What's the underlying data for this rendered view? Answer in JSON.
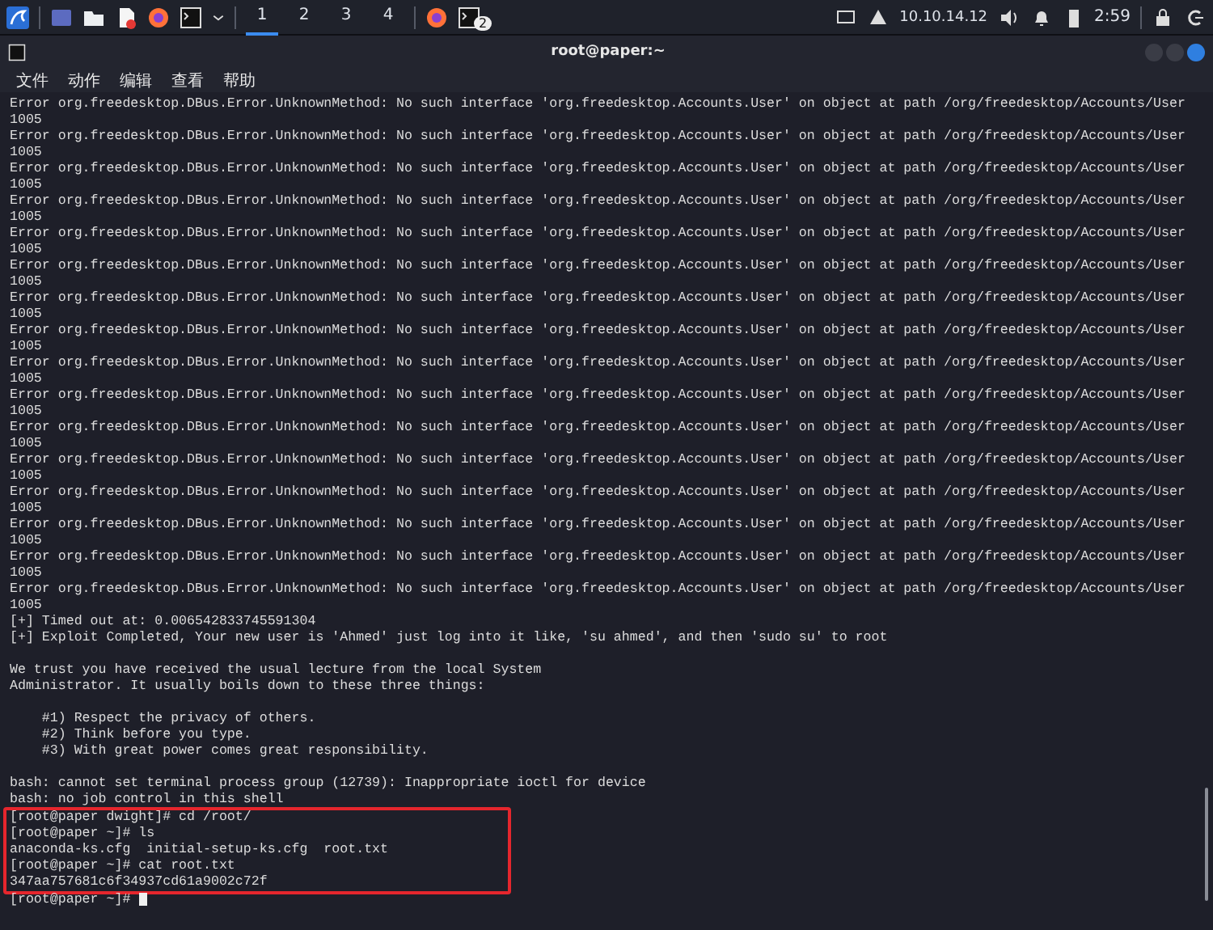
{
  "taskbar": {
    "workspaces": [
      {
        "label": "1",
        "selected": true
      },
      {
        "label": "2",
        "selected": false
      },
      {
        "label": "3",
        "selected": false
      },
      {
        "label": "4",
        "selected": false
      }
    ],
    "terminal_badge": "2",
    "ip": "10.10.14.12",
    "time": "2:59"
  },
  "window": {
    "title": "root@paper:~"
  },
  "menu": [
    "文件",
    "动作",
    "编辑",
    "查看",
    "帮助"
  ],
  "terminal": {
    "lines": [
      {
        "kind": "line",
        "text": "Error org.freedesktop.DBus.Error.UnknownMethod: No such interface 'org.freedesktop.Accounts.User' on object at path /org/freedesktop/Accounts/User"
      },
      {
        "kind": "line",
        "text": "1005"
      },
      {
        "kind": "line",
        "text": "Error org.freedesktop.DBus.Error.UnknownMethod: No such interface 'org.freedesktop.Accounts.User' on object at path /org/freedesktop/Accounts/User"
      },
      {
        "kind": "line",
        "text": "1005"
      },
      {
        "kind": "line",
        "text": "Error org.freedesktop.DBus.Error.UnknownMethod: No such interface 'org.freedesktop.Accounts.User' on object at path /org/freedesktop/Accounts/User"
      },
      {
        "kind": "line",
        "text": "1005"
      },
      {
        "kind": "line",
        "text": "Error org.freedesktop.DBus.Error.UnknownMethod: No such interface 'org.freedesktop.Accounts.User' on object at path /org/freedesktop/Accounts/User"
      },
      {
        "kind": "line",
        "text": "1005"
      },
      {
        "kind": "line",
        "text": "Error org.freedesktop.DBus.Error.UnknownMethod: No such interface 'org.freedesktop.Accounts.User' on object at path /org/freedesktop/Accounts/User"
      },
      {
        "kind": "line",
        "text": "1005"
      },
      {
        "kind": "line",
        "text": "Error org.freedesktop.DBus.Error.UnknownMethod: No such interface 'org.freedesktop.Accounts.User' on object at path /org/freedesktop/Accounts/User"
      },
      {
        "kind": "line",
        "text": "1005"
      },
      {
        "kind": "line",
        "text": "Error org.freedesktop.DBus.Error.UnknownMethod: No such interface 'org.freedesktop.Accounts.User' on object at path /org/freedesktop/Accounts/User"
      },
      {
        "kind": "line",
        "text": "1005"
      },
      {
        "kind": "line",
        "text": "Error org.freedesktop.DBus.Error.UnknownMethod: No such interface 'org.freedesktop.Accounts.User' on object at path /org/freedesktop/Accounts/User"
      },
      {
        "kind": "line",
        "text": "1005"
      },
      {
        "kind": "line",
        "text": "Error org.freedesktop.DBus.Error.UnknownMethod: No such interface 'org.freedesktop.Accounts.User' on object at path /org/freedesktop/Accounts/User"
      },
      {
        "kind": "line",
        "text": "1005"
      },
      {
        "kind": "line",
        "text": "Error org.freedesktop.DBus.Error.UnknownMethod: No such interface 'org.freedesktop.Accounts.User' on object at path /org/freedesktop/Accounts/User"
      },
      {
        "kind": "line",
        "text": "1005"
      },
      {
        "kind": "line",
        "text": "Error org.freedesktop.DBus.Error.UnknownMethod: No such interface 'org.freedesktop.Accounts.User' on object at path /org/freedesktop/Accounts/User"
      },
      {
        "kind": "line",
        "text": "1005"
      },
      {
        "kind": "line",
        "text": "Error org.freedesktop.DBus.Error.UnknownMethod: No such interface 'org.freedesktop.Accounts.User' on object at path /org/freedesktop/Accounts/User"
      },
      {
        "kind": "line",
        "text": "1005"
      },
      {
        "kind": "line",
        "text": "Error org.freedesktop.DBus.Error.UnknownMethod: No such interface 'org.freedesktop.Accounts.User' on object at path /org/freedesktop/Accounts/User"
      },
      {
        "kind": "line",
        "text": "1005"
      },
      {
        "kind": "line",
        "text": "Error org.freedesktop.DBus.Error.UnknownMethod: No such interface 'org.freedesktop.Accounts.User' on object at path /org/freedesktop/Accounts/User"
      },
      {
        "kind": "line",
        "text": "1005"
      },
      {
        "kind": "line",
        "text": "Error org.freedesktop.DBus.Error.UnknownMethod: No such interface 'org.freedesktop.Accounts.User' on object at path /org/freedesktop/Accounts/User"
      },
      {
        "kind": "line",
        "text": "1005"
      },
      {
        "kind": "line",
        "text": "Error org.freedesktop.DBus.Error.UnknownMethod: No such interface 'org.freedesktop.Accounts.User' on object at path /org/freedesktop/Accounts/User"
      },
      {
        "kind": "line",
        "text": "1005"
      },
      {
        "kind": "line",
        "text": "[+] Timed out at: 0.006542833745591304"
      },
      {
        "kind": "line",
        "text": "[+] Exploit Completed, Your new user is 'Ahmed' just log into it like, 'su ahmed', and then 'sudo su' to root"
      },
      {
        "kind": "blank"
      },
      {
        "kind": "line",
        "text": "We trust you have received the usual lecture from the local System"
      },
      {
        "kind": "line",
        "text": "Administrator. It usually boils down to these three things:"
      },
      {
        "kind": "blank"
      },
      {
        "kind": "line",
        "text": "    #1) Respect the privacy of others."
      },
      {
        "kind": "line",
        "text": "    #2) Think before you type."
      },
      {
        "kind": "line",
        "text": "    #3) With great power comes great responsibility."
      },
      {
        "kind": "blank"
      },
      {
        "kind": "line",
        "text": "bash: cannot set terminal process group (12739): Inappropriate ioctl for device"
      },
      {
        "kind": "line",
        "text": "bash: no job control in this shell"
      }
    ],
    "highlighted": [
      "[root@paper dwight]# cd /root/",
      "[root@paper ~]# ls",
      "anaconda-ks.cfg  initial-setup-ks.cfg  root.txt",
      "[root@paper ~]# cat root.txt",
      "347aa757681c6f34937cd61a9002c72f"
    ],
    "prompt": "[root@paper ~]#"
  }
}
